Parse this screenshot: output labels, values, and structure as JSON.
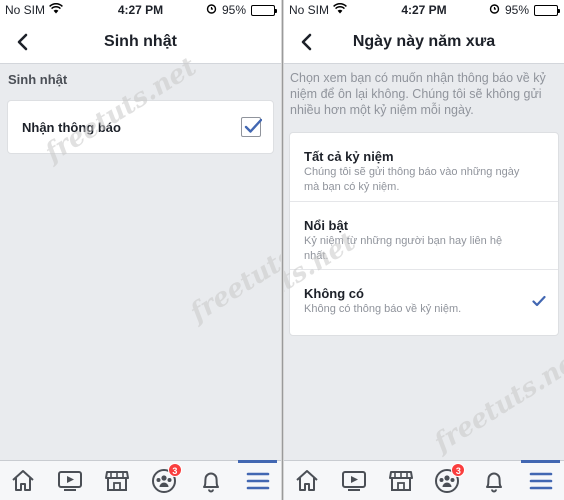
{
  "status_bar": {
    "carrier": "No SIM",
    "time": "4:27 PM",
    "battery": "95%",
    "battery_level": 0.95
  },
  "left_screen": {
    "title": "Sinh nhật",
    "section_header": "Sinh nhật",
    "notification_label": "Nhận thông báo",
    "notification_checked": true
  },
  "right_screen": {
    "title": "Ngày này năm xưa",
    "description": "Chọn xem bạn có muốn nhận thông báo về kỷ niệm để ôn lại không. Chúng tôi sẽ không gửi nhiều hơn một kỷ niệm mỗi ngày.",
    "options": [
      {
        "title": "Tất cả kỷ niệm",
        "subtitle": "Chúng tôi sẽ gửi thông báo vào những ngày mà bạn có kỷ niệm.",
        "selected": false
      },
      {
        "title": "Nổi bật",
        "subtitle": "Kỷ niệm từ những người bạn hay liên hệ nhất.",
        "selected": false
      },
      {
        "title": "Không có",
        "subtitle": "Không có thông báo về kỷ niệm.",
        "selected": true
      }
    ]
  },
  "tab_bar": {
    "tabs": [
      "home-icon",
      "video-icon",
      "marketplace-icon",
      "groups-icon",
      "notifications-icon",
      "menu-icon"
    ],
    "groups_badge": "3",
    "active_tab": "menu-icon"
  },
  "watermark": {
    "text": "freetuts.net"
  },
  "colors": {
    "accent": "#4267b2",
    "badge": "#fa3e3e",
    "background": "#e9ebee"
  }
}
